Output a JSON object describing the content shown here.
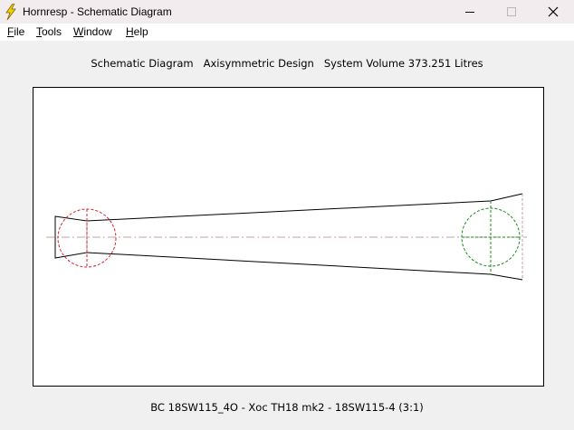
{
  "window": {
    "title": "Hornresp - Schematic Diagram",
    "icon": "lightning-bolt-icon"
  },
  "menu": {
    "file": {
      "accel": "F",
      "rest": "ile"
    },
    "tools": {
      "accel": "T",
      "rest": "ools"
    },
    "window": {
      "accel": "W",
      "rest": "indow"
    },
    "help": {
      "accel": "H",
      "rest": "elp"
    }
  },
  "diagram": {
    "heading": "Schematic Diagram   Axisymmetric Design   System Volume 373.251 Litres",
    "caption": "BC 18SW115_4O - Xoc TH18 mk2 - 18SW115-4 (3:1)",
    "colors": {
      "outline": "#000000",
      "axis": "#c4a0a0",
      "rear_driver": "#d8202c",
      "front_driver": "#1a8a1a"
    }
  }
}
